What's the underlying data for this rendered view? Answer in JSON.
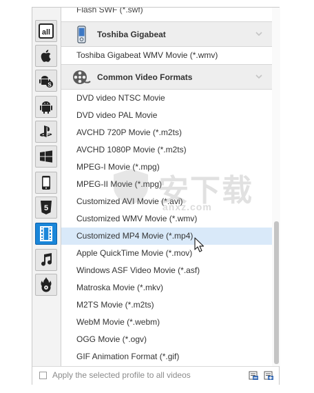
{
  "sidebar": {
    "items": [
      {
        "name": "all",
        "label": "all",
        "active": false
      },
      {
        "name": "apple",
        "active": false
      },
      {
        "name": "android-s",
        "active": false
      },
      {
        "name": "android",
        "active": false
      },
      {
        "name": "playstation",
        "active": false
      },
      {
        "name": "windows",
        "active": false
      },
      {
        "name": "phone",
        "active": false
      },
      {
        "name": "html5",
        "label": "5",
        "active": false
      },
      {
        "name": "video",
        "active": true
      },
      {
        "name": "music",
        "active": false
      },
      {
        "name": "flash",
        "active": false
      }
    ]
  },
  "list": {
    "partial_top": "Flash SWF (*.swf)",
    "groups": [
      {
        "title": "Toshiba Gigabeat",
        "items": [
          "Toshiba Gigabeat WMV Movie (*.wmv)"
        ]
      },
      {
        "title": "Common Video Formats",
        "items": [
          "DVD video NTSC Movie",
          "DVD video PAL Movie",
          "AVCHD 720P Movie (*.m2ts)",
          "AVCHD 1080P Movie (*.m2ts)",
          "MPEG-I Movie (*.mpg)",
          "MPEG-II Movie (*.mpg)",
          "Customized AVI Movie (*.avi)",
          "Customized WMV Movie (*.wmv)",
          "Customized MP4 Movie (*.mp4)",
          "Apple QuickTime Movie (*.mov)",
          "Windows ASF Video Movie (*.asf)",
          "Matroska Movie (*.mkv)",
          "M2TS Movie (*.m2ts)",
          "WebM Movie (*.webm)",
          "OGG Movie (*.ogv)",
          "GIF Animation Format (*.gif)"
        ]
      }
    ],
    "selected": "Customized MP4 Movie (*.mp4)"
  },
  "footer": {
    "checkbox_label": "Apply the selected profile to all videos",
    "checked": false
  },
  "watermark": {
    "text": "安下载",
    "sub": "anxz.com"
  },
  "colors": {
    "accent": "#1a86d9",
    "selected_row": "#d9e9f9",
    "group_bg": "#eeeeee"
  }
}
